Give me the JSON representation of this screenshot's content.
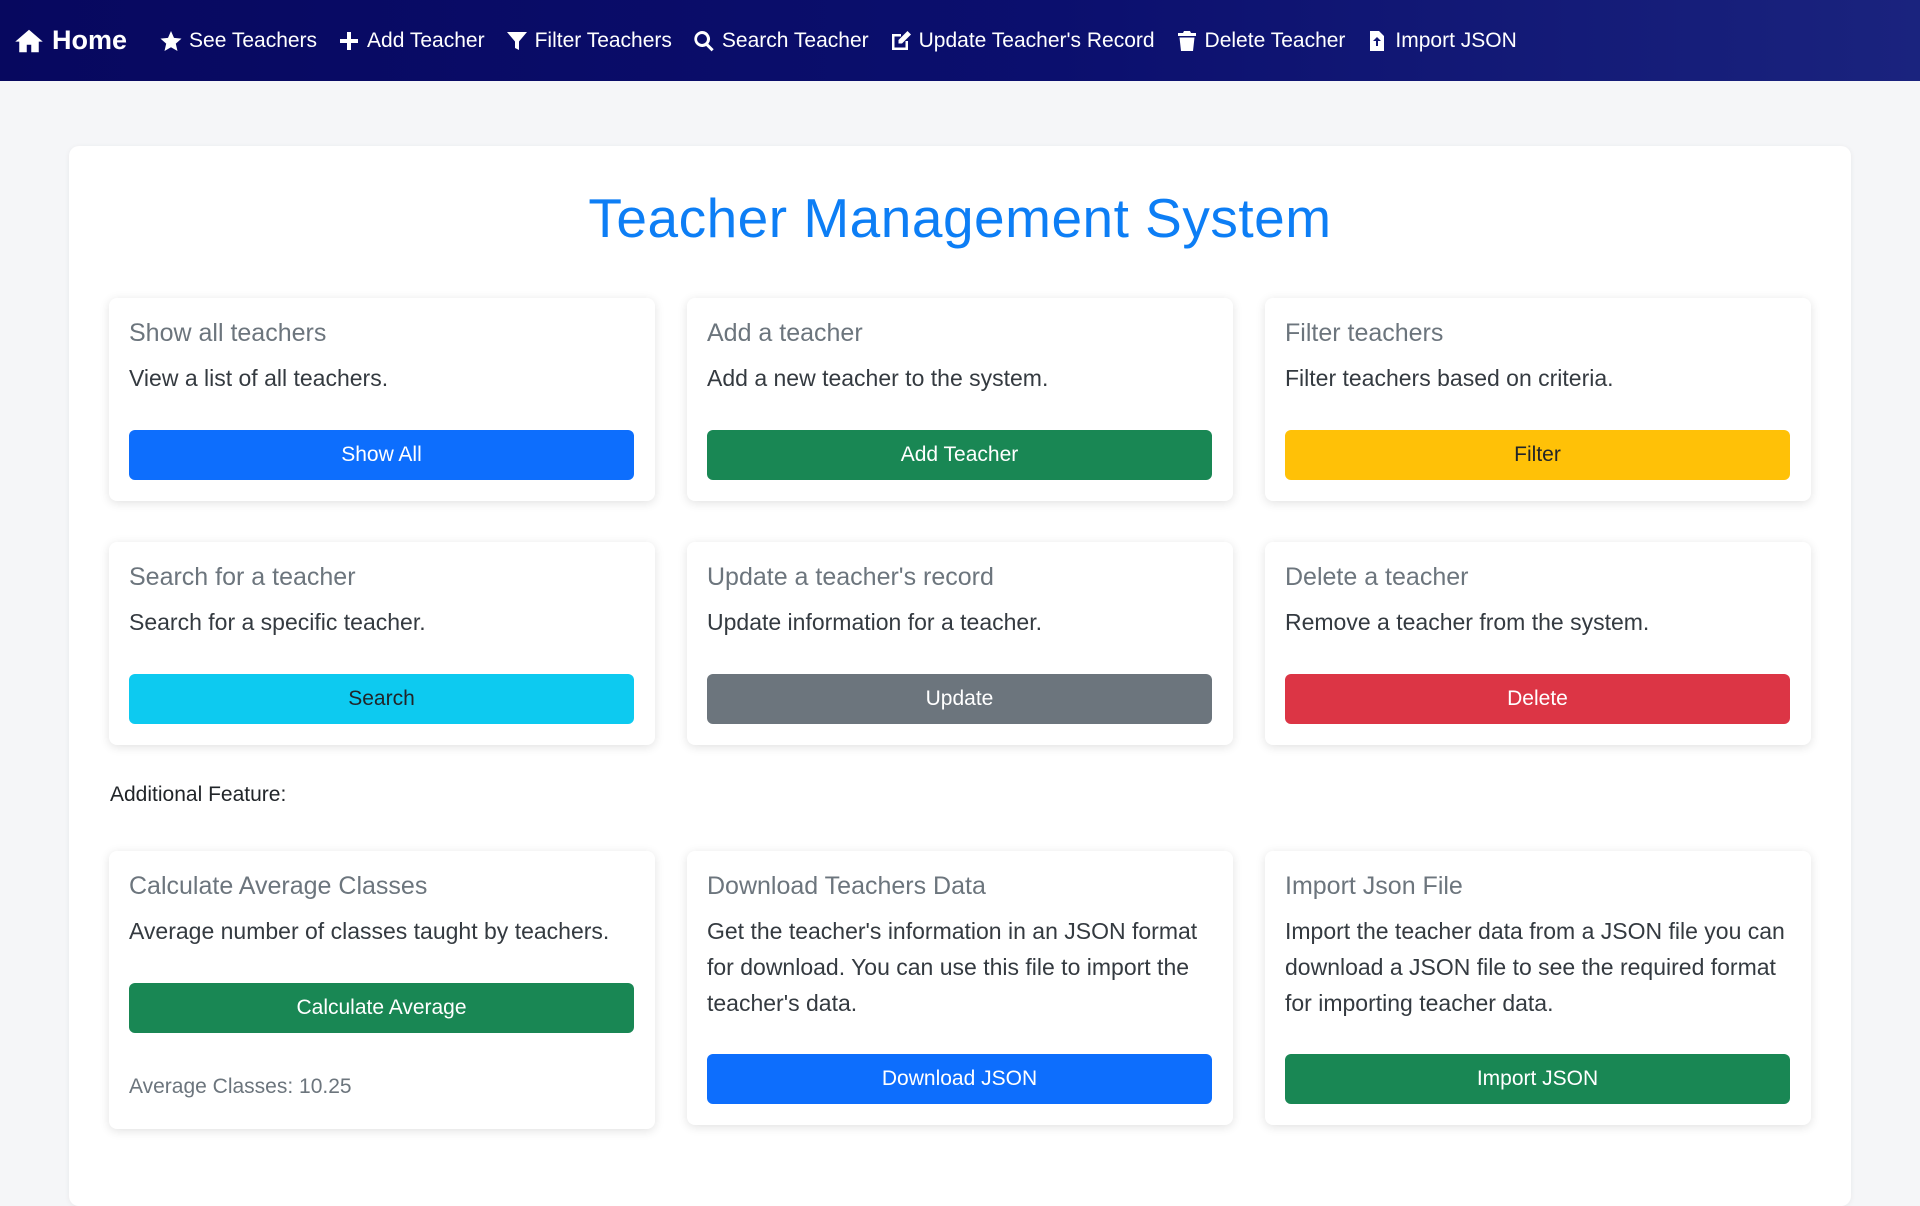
{
  "nav": {
    "home": "Home",
    "items": [
      {
        "label": "See Teachers",
        "icon": "star-icon"
      },
      {
        "label": "Add Teacher",
        "icon": "plus-icon"
      },
      {
        "label": "Filter Teachers",
        "icon": "filter-icon"
      },
      {
        "label": "Search Teacher",
        "icon": "search-icon"
      },
      {
        "label": "Update Teacher's Record",
        "icon": "edit-icon"
      },
      {
        "label": "Delete Teacher",
        "icon": "trash-icon"
      },
      {
        "label": "Import JSON",
        "icon": "file-import-icon"
      }
    ]
  },
  "page": {
    "title": "Teacher Management System",
    "additional_label": "Additional Feature:"
  },
  "cards": [
    {
      "title": "Show all teachers",
      "text": "View a list of all teachers.",
      "button": "Show All"
    },
    {
      "title": "Add a teacher",
      "text": "Add a new teacher to the system.",
      "button": "Add Teacher"
    },
    {
      "title": "Filter teachers",
      "text": "Filter teachers based on criteria.",
      "button": "Filter"
    },
    {
      "title": "Search for a teacher",
      "text": "Search for a specific teacher.",
      "button": "Search"
    },
    {
      "title": "Update a teacher's record",
      "text": "Update information for a teacher.",
      "button": "Update"
    },
    {
      "title": "Delete a teacher",
      "text": "Remove a teacher from the system.",
      "button": "Delete"
    }
  ],
  "extra_cards": [
    {
      "title": "Calculate Average Classes",
      "text": "Average number of classes taught by teachers.",
      "button": "Calculate Average",
      "result": "Average Classes: 10.25"
    },
    {
      "title": "Download Teachers Data",
      "text": "Get the teacher's information in an JSON format for download. You can use this file to import the teacher's data.",
      "button": "Download JSON"
    },
    {
      "title": "Import Json File",
      "text": "Import the teacher data from a JSON file you can download a JSON file to see the required format for importing teacher data.",
      "button": "Import JSON"
    }
  ],
  "colors": {
    "primary": "#0d6efd",
    "success": "#198754",
    "warning": "#ffc107",
    "info": "#0dcaf0",
    "secondary": "#6c757d",
    "danger": "#dc3545",
    "title": "#0d7ef5",
    "navbar": "#0b0f6e"
  }
}
